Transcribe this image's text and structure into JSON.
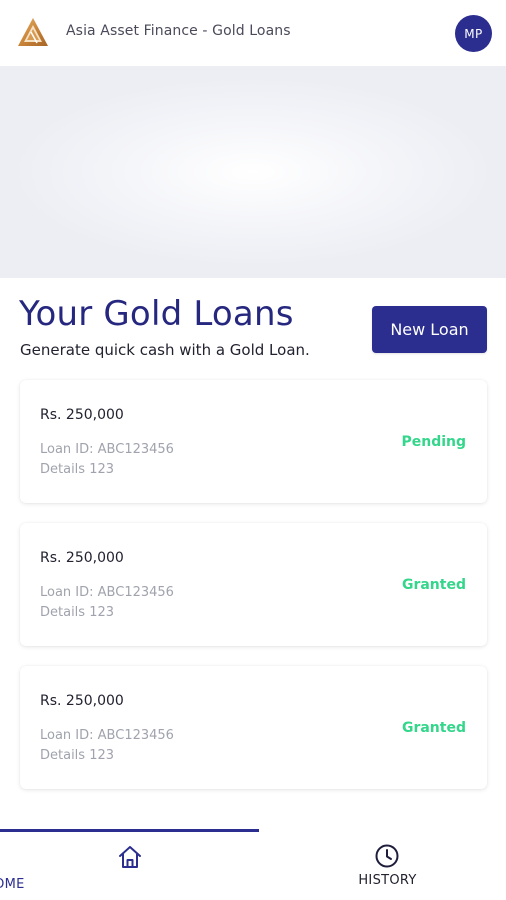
{
  "header": {
    "app_title": "Asia Asset Finance - Gold Loans",
    "avatar_initials": "MP",
    "logo_icon": "gold-triangle-logo-icon"
  },
  "colors": {
    "primary": "#2b2d8f",
    "status_green": "#33d68a",
    "muted_text": "#a0a3ad"
  },
  "section": {
    "title": "Your Gold Loans",
    "subtitle": "Generate quick cash with a Gold Loan.",
    "new_loan_label": "New Loan"
  },
  "loans": [
    {
      "amount": "Rs. 250,000",
      "loan_id": "Loan ID: ABC123456",
      "details": "Details 123",
      "status": "Pending"
    },
    {
      "amount": "Rs. 250,000",
      "loan_id": "Loan ID: ABC123456",
      "details": "Details 123",
      "status": "Granted"
    },
    {
      "amount": "Rs. 250,000",
      "loan_id": "Loan ID: ABC123456",
      "details": "Details 123",
      "status": "Granted"
    }
  ],
  "bottom_nav": {
    "items": [
      {
        "label": "HOME",
        "icon": "home-icon",
        "active": true
      },
      {
        "label": "HISTORY",
        "icon": "clock-icon",
        "active": false
      }
    ]
  }
}
